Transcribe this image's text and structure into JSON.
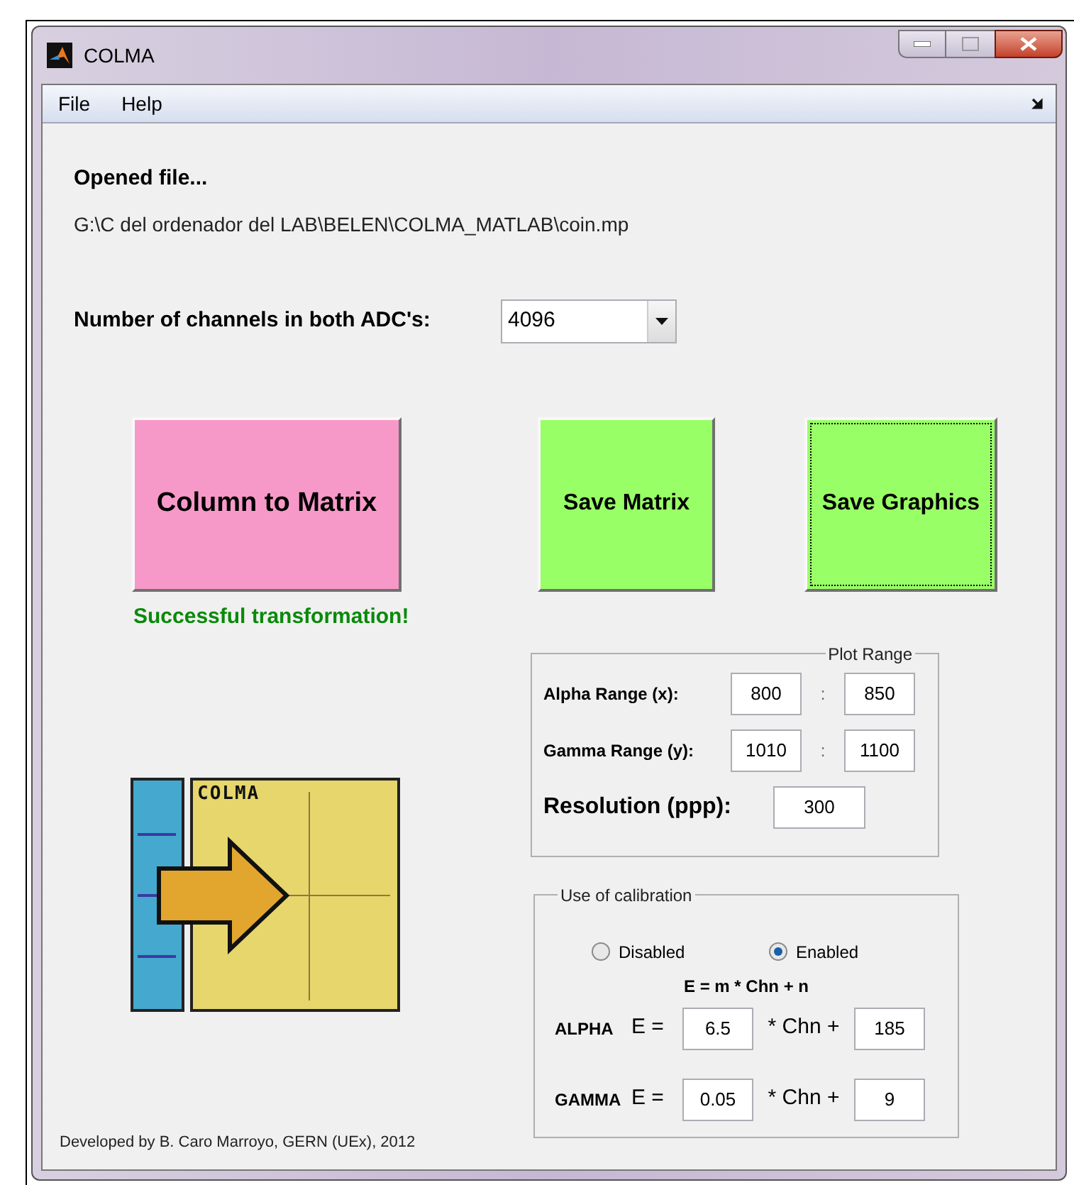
{
  "window": {
    "title": "COLMA"
  },
  "menu": [
    {
      "label": "File"
    },
    {
      "label": "Help"
    }
  ],
  "opened_file": {
    "label": "Opened file...",
    "path": "G:\\C del ordenador del LAB\\BELEN\\COLMA_MATLAB\\coin.mp"
  },
  "channels": {
    "label": "Number of channels in both ADC's:",
    "value": "4096"
  },
  "buttons": [
    {
      "label": "Column to Matrix",
      "color": "#f799c8",
      "focused": false
    },
    {
      "label": "Save Matrix",
      "color": "#99ff66",
      "focused": false
    },
    {
      "label": "Save Graphics",
      "color": "#99ff66",
      "focused": true
    }
  ],
  "status": "Successful transformation!",
  "logo": {
    "text": "COLMA"
  },
  "plot_range": {
    "title": "Plot Range",
    "rows": [
      {
        "label": "Alpha Range (x):",
        "from": "800",
        "separator": ":",
        "to": "850"
      },
      {
        "label": "Gamma Range (y):",
        "from": "1010",
        "separator": ":",
        "to": "1100"
      }
    ],
    "resolution": {
      "label": "Resolution (ppp):",
      "value": "300"
    }
  },
  "calibration": {
    "title": "Use of calibration",
    "options": [
      {
        "label": "Disabled",
        "selected": false
      },
      {
        "label": "Enabled",
        "selected": true
      }
    ],
    "formula": "E = m * Chn + n",
    "rows": [
      {
        "name": "ALPHA",
        "e_label": "E =",
        "m": "6.5",
        "times": "* Chn +",
        "n": "185"
      },
      {
        "name": "GAMMA",
        "e_label": "E =",
        "m": "0.05",
        "times": "* Chn +",
        "n": "9"
      }
    ]
  },
  "footer": "Developed by  B. Caro Marroyo, GERN (UEx), 2012"
}
